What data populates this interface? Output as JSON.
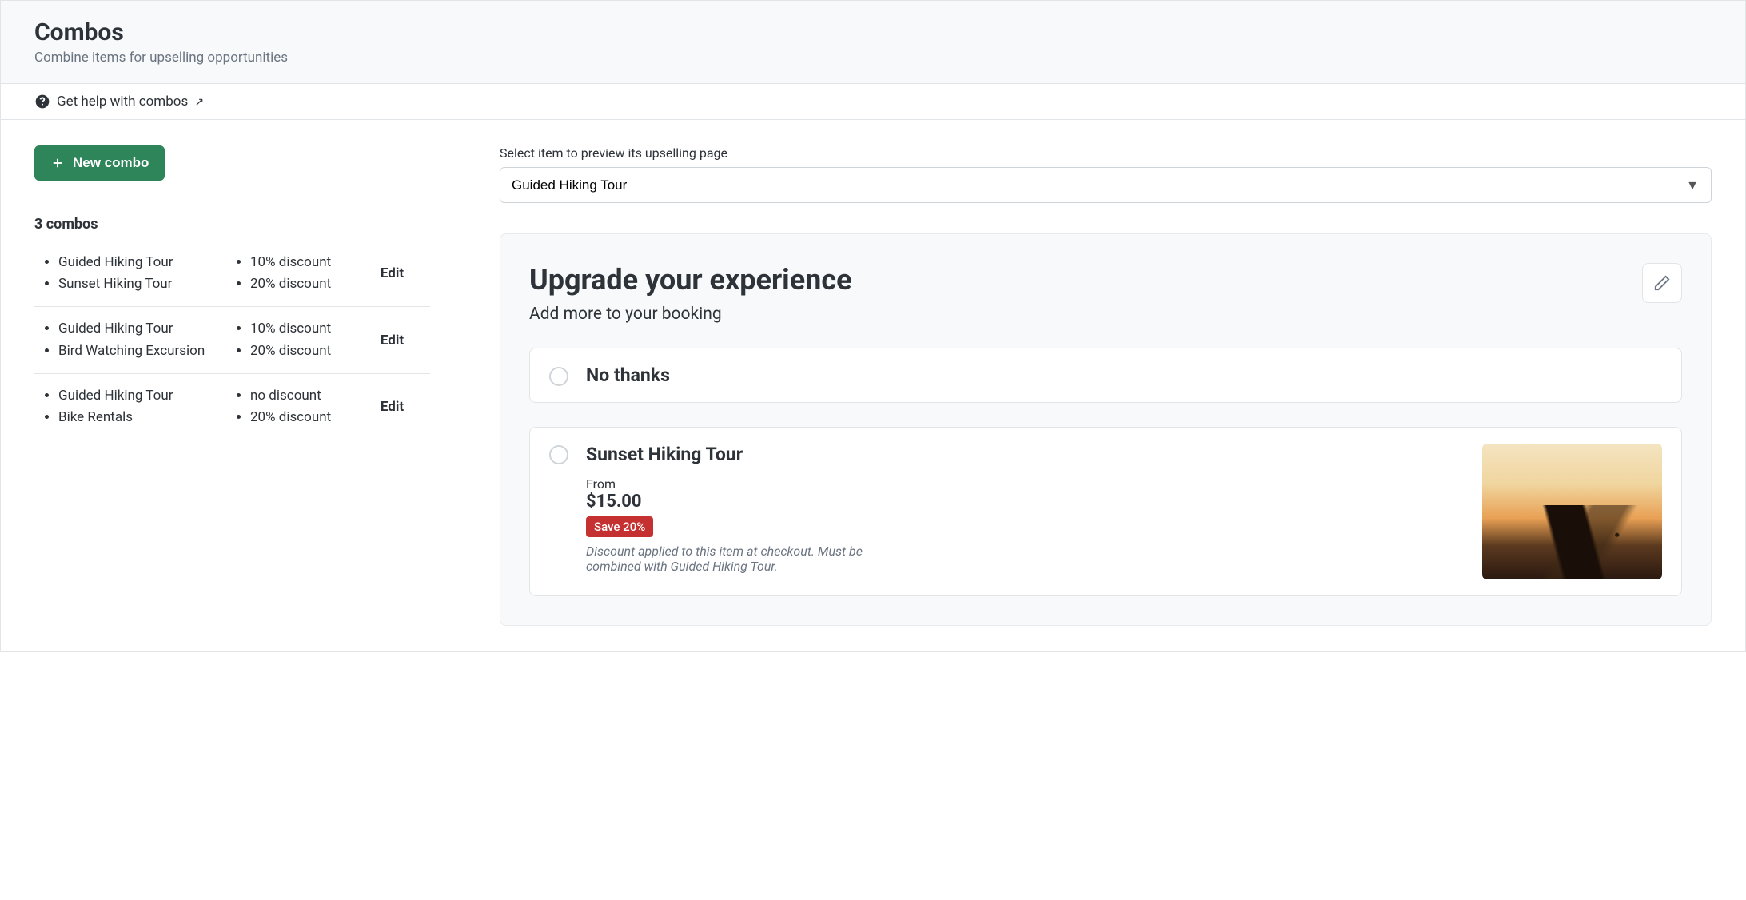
{
  "header": {
    "title": "Combos",
    "subtitle": "Combine items for upselling opportunities"
  },
  "help": {
    "text": "Get help with combos",
    "suffix": "↗"
  },
  "actions": {
    "new_combo": "New combo"
  },
  "combo_count_label": "3 combos",
  "combos": [
    {
      "items": [
        "Guided Hiking Tour",
        "Sunset Hiking Tour"
      ],
      "discounts": [
        "10% discount",
        "20% discount"
      ],
      "edit_label": "Edit"
    },
    {
      "items": [
        "Guided Hiking Tour",
        "Bird Watching Excursion"
      ],
      "discounts": [
        "10% discount",
        "20% discount"
      ],
      "edit_label": "Edit"
    },
    {
      "items": [
        "Guided Hiking Tour",
        "Bike Rentals"
      ],
      "discounts": [
        "no discount",
        "20% discount"
      ],
      "edit_label": "Edit"
    }
  ],
  "preview": {
    "label": "Select item to preview its upselling page",
    "selected": "Guided Hiking Tour",
    "card": {
      "title": "Upgrade your experience",
      "subtitle": "Add more to your booking",
      "no_thanks": "No thanks",
      "offer": {
        "name": "Sunset Hiking Tour",
        "from_label": "From",
        "price": "$15.00",
        "badge": "Save 20%",
        "note": "Discount applied to this item at checkout. Must be combined with Guided Hiking Tour."
      }
    }
  }
}
